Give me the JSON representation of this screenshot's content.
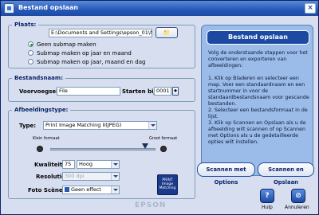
{
  "window": {
    "title": "Bestand opslaan",
    "close_glyph": "×"
  },
  "plaats": {
    "group_title": "Plaats:",
    "path_value": "E:\\Documents and Settings\\epson_01\\M",
    "browse_glyph": "📁",
    "options": [
      {
        "label": "Geen submap maken",
        "selected": true
      },
      {
        "label": "Submap maken op jaar en maand",
        "selected": false
      },
      {
        "label": "Submap maken op jaar, maand en dag",
        "selected": false
      }
    ]
  },
  "bestandsnaam": {
    "group_title": "Bestandsnaam:",
    "prefix_label": "Voorvoegsel:",
    "prefix_value": "File",
    "start_label": "Starten bij:",
    "start_value": "0001"
  },
  "afbeeldingstype": {
    "group_title": "Afbeeldingstype:",
    "type_label": "Type:",
    "type_value": "Print Image Matching II(JPEG)",
    "small_label": "Klein formaat",
    "large_label": "Groot formaat",
    "quality_label": "Kwaliteit:",
    "quality_value": "75",
    "quality_select": "Hoog",
    "resolution_label": "Resolutie:",
    "resolution_value": "300 dpi",
    "scene_label": "Foto Scène:",
    "scene_value": "Geen effect",
    "pim_logo_text": "PRINT Image Matching",
    "slider_level": 0.9
  },
  "help_panel": {
    "title": "Bestand opslaan",
    "text": "Volg de onderstaande stappen voor het converteren en exporteren van afbeeldingen:\n\n1. Klik op Bladeren en selecteer een map. Voer een standaardnaam en een startnummer in voor de standaardbestandsnaam voor gescande bestanden.\n2. Selecteer een bestandsformaat in de lijst.\n3. Klik op Scannen en Opslaan als u de afbeelding wilt scannen of op Scannen met Options als u de gedetailleerde opties wilt instellen."
  },
  "buttons": {
    "scan_with_options": "Scannen met Options",
    "scan_and_save": "Scannen en Opslaan",
    "help": "Hulp",
    "cancel": "Annuleren"
  },
  "watermark": "EPSON",
  "colors": {
    "accent": "#1c4aa3",
    "panel": "#9bbbe8",
    "window_bg": "#d7def0"
  }
}
